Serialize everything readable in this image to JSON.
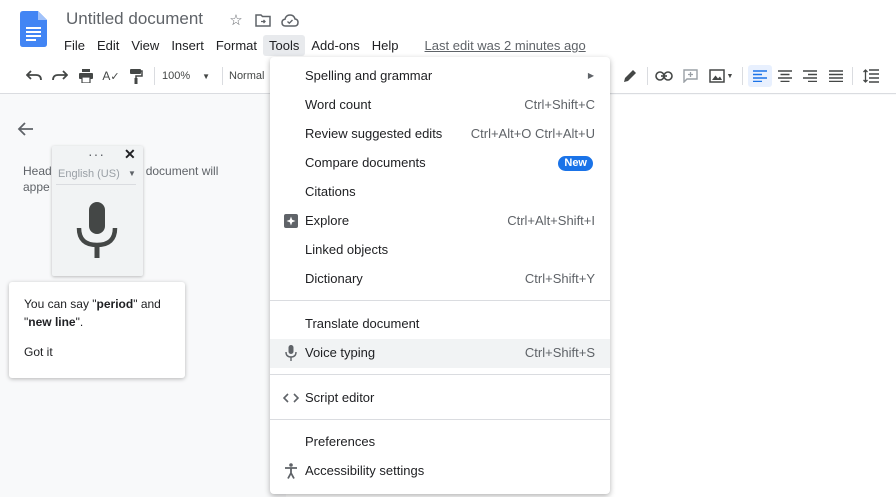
{
  "header": {
    "doc_title": "Untitled document",
    "last_edit": "Last edit was 2 minutes ago",
    "icons": [
      "star-icon",
      "move-folder-icon",
      "cloud-status-icon"
    ]
  },
  "menubar": {
    "items": [
      "File",
      "Edit",
      "View",
      "Insert",
      "Format",
      "Tools",
      "Add-ons",
      "Help"
    ],
    "active": "Tools"
  },
  "toolbar": {
    "zoom": "100%",
    "style": "Normal",
    "icons": [
      "undo-icon",
      "redo-icon",
      "print-icon",
      "spellcheck-icon",
      "paint-format-icon",
      "edit-mode-icon",
      "link-icon",
      "comment-icon",
      "image-icon",
      "align-left-icon",
      "align-center-icon",
      "align-right-icon",
      "justify-icon",
      "line-spacing-icon"
    ]
  },
  "outline": {
    "text_before": "Head",
    "text_after": "e document will",
    "text_line2": "appe"
  },
  "voice_widget": {
    "more": "···",
    "close": "✕",
    "language": "English (US)"
  },
  "voice_tip": {
    "text_prefix": "You can say \"",
    "period": "period",
    "text_mid": "\" and \"",
    "new_line": "new line",
    "text_suffix": "\".",
    "got_it": "Got it"
  },
  "tools_menu": {
    "items": [
      {
        "label": "Spelling and grammar",
        "shortcut": "",
        "submenu": true
      },
      {
        "label": "Word count",
        "shortcut": "Ctrl+Shift+C"
      },
      {
        "label": "Review suggested edits",
        "shortcut": "Ctrl+Alt+O Ctrl+Alt+U"
      },
      {
        "label": "Compare documents",
        "badge": "New"
      },
      {
        "label": "Citations",
        "shortcut": ""
      },
      {
        "label": "Explore",
        "shortcut": "Ctrl+Alt+Shift+I",
        "icon": "explore-icon"
      },
      {
        "label": "Linked objects",
        "shortcut": ""
      },
      {
        "label": "Dictionary",
        "shortcut": "Ctrl+Shift+Y"
      },
      {
        "label": "Translate document",
        "shortcut": ""
      },
      {
        "label": "Voice typing",
        "shortcut": "Ctrl+Shift+S",
        "icon": "microphone-icon",
        "highlighted": true
      },
      {
        "label": "Script editor",
        "shortcut": "",
        "icon": "code-icon"
      },
      {
        "label": "Preferences",
        "shortcut": ""
      },
      {
        "label": "Accessibility settings",
        "shortcut": "",
        "icon": "accessibility-icon"
      }
    ]
  },
  "colors": {
    "accent": "#1a73e8",
    "docs_blue": "#4285f4"
  }
}
